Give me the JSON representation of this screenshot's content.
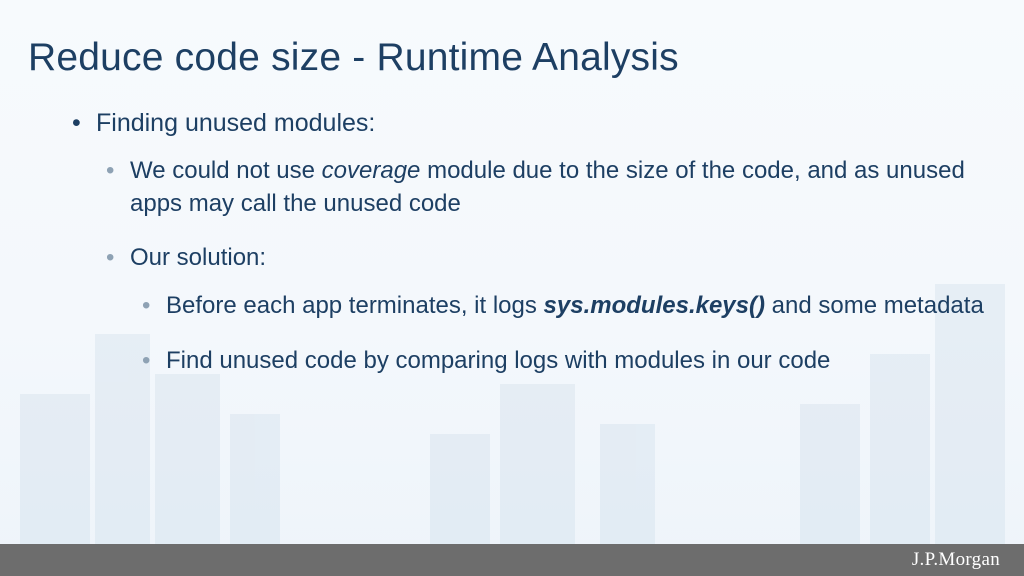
{
  "title": "Reduce code size - Runtime Analysis",
  "bullets": {
    "l1": "Finding unused modules:",
    "l2a_pre": "We could not use ",
    "l2a_em": "coverage",
    "l2a_post": " module due to the size of the code, and as unused apps may call the unused code",
    "l2b": "Our solution:",
    "l3a_pre": "Before each app terminates, it logs ",
    "l3a_em": "sys.modules.keys()",
    "l3a_post": " and some metadata",
    "l3b": "Find unused code by comparing logs with modules in our code"
  },
  "footer": {
    "brand": "J.P.Morgan"
  },
  "colors": {
    "text": "#1d3f63",
    "subbullet": "#8ea2b4",
    "footer_bg": "#6d6d6d",
    "footer_text": "#ffffff",
    "bg_top": "#f7fafd",
    "bg_bottom": "#eef4fa"
  }
}
